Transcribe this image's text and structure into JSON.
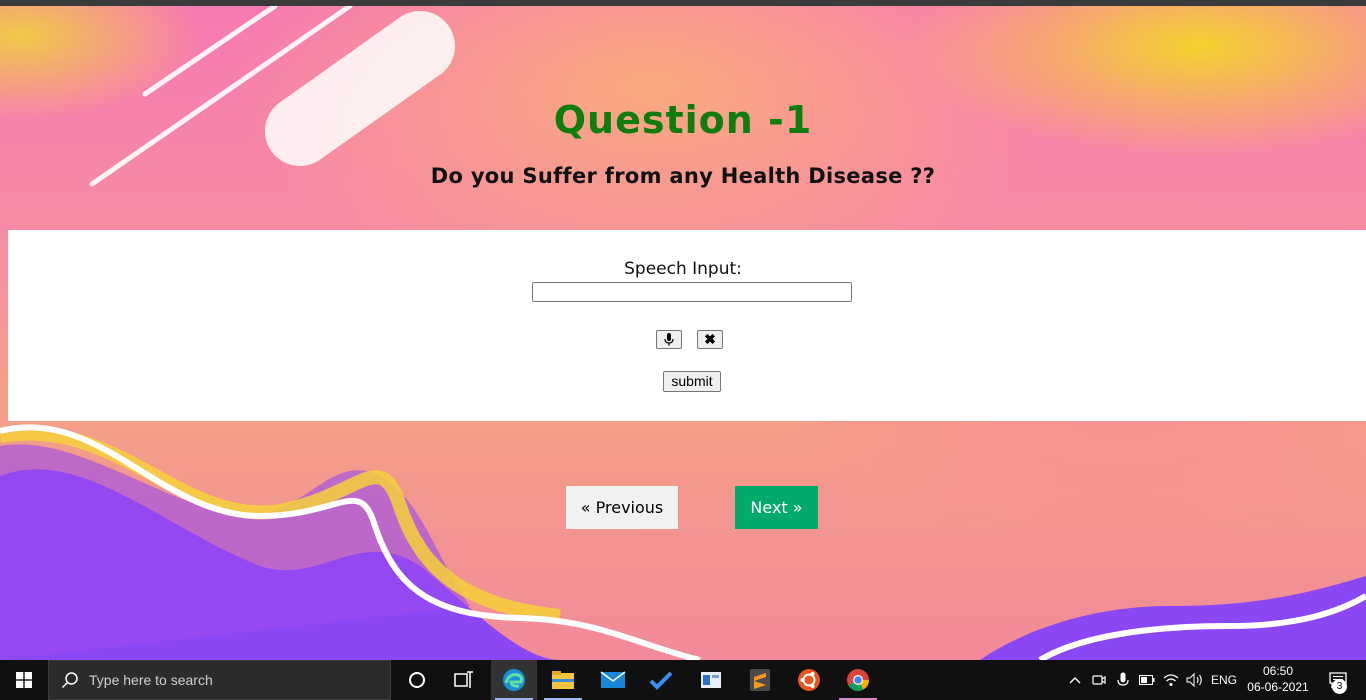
{
  "quiz": {
    "title": "Question -1",
    "question": "Do you Suffer from any Health Disease ??",
    "speech_label": "Speech Input:",
    "speech_value": "",
    "clear_label": "✖",
    "submit_label": "submit",
    "previous_label": "« Previous",
    "next_label": "Next »"
  },
  "colors": {
    "title": "#0e7d0e",
    "next_button": "#04aa6d",
    "previous_button": "#f1f1f1"
  },
  "taskbar": {
    "search_placeholder": "Type here to search",
    "apps": [
      "task-view-icon",
      "edge-icon",
      "file-explorer-icon",
      "mail-icon",
      "todo-icon",
      "app-window-icon",
      "sublime-text-icon",
      "ubuntu-icon",
      "chrome-icon"
    ],
    "language": "ENG",
    "time": "06:50",
    "date": "06-06-2021",
    "notification_count": "3"
  }
}
